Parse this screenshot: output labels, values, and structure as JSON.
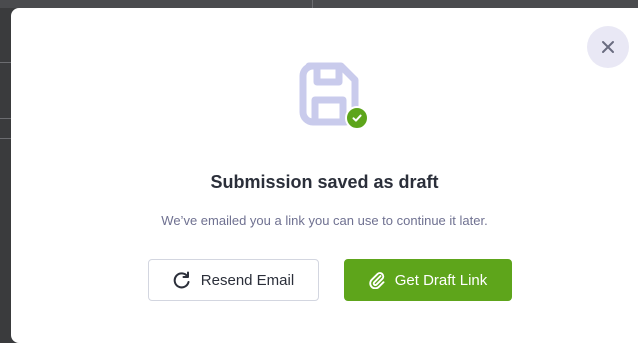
{
  "dialog": {
    "title": "Submission saved as draft",
    "message": "We’ve emailed you a link you can use to continue it later.",
    "close_icon": "close-icon",
    "status_icon": "save-icon",
    "badge_icon": "check-icon"
  },
  "actions": {
    "resend": {
      "label": "Resend Email",
      "icon": "refresh-icon"
    },
    "draft_link": {
      "label": "Get Draft Link",
      "icon": "paperclip-icon"
    }
  },
  "colors": {
    "accent_green": "#5ea51b",
    "icon_lavender": "#c9cbec",
    "close_bg": "#e9e8f5",
    "title_text": "#2b2f3a",
    "muted_text": "#6f7191"
  }
}
